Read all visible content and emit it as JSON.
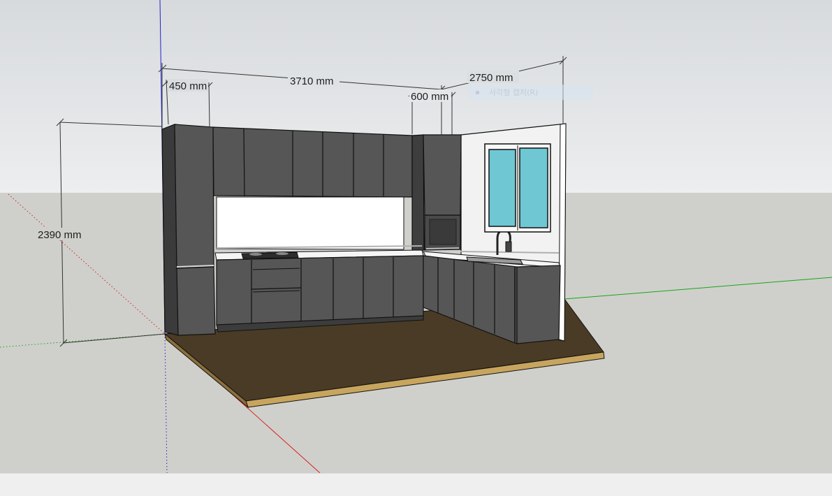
{
  "dimensions": {
    "total_length": "3710 mm",
    "tall_cabinet_width": "450 mm",
    "side_cabinet_width": "600 mm",
    "side_length": "2750 mm",
    "height": "2390 mm"
  },
  "tooltip": {
    "label": "사각형 캡처(R)"
  },
  "colors": {
    "sky_top": "#d9dcdf",
    "ground": "#cfd0cb",
    "cabinet": "#565656",
    "cabinet_dark": "#3e3e3e",
    "floor": "#4a3b26",
    "window_glass": "#6fc7d4",
    "axis_red": "#d82020",
    "axis_green": "#1aa51a",
    "axis_blue": "#2020c8"
  },
  "icons": [
    "rectangle-capture-icon"
  ]
}
